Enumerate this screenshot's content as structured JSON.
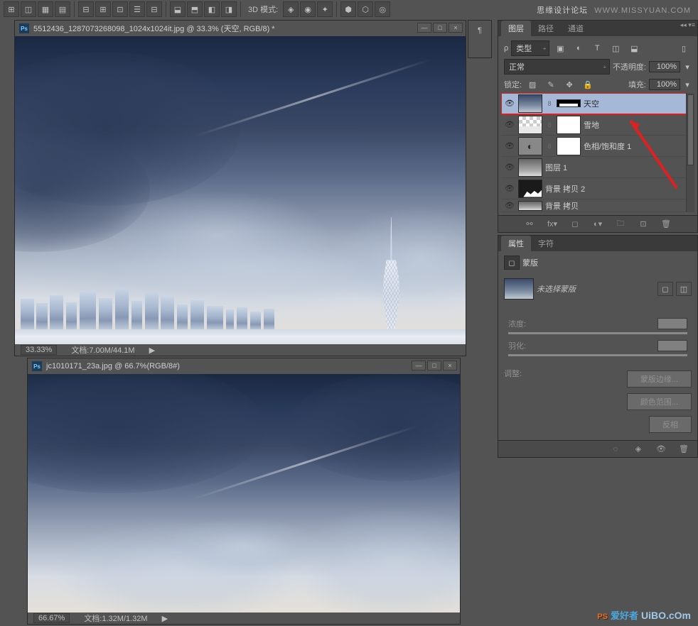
{
  "toolbar": {
    "mode_label": "3D 模式:"
  },
  "watermark_top": {
    "cn": "思缘设计论坛",
    "url": "WWW.MISSYUAN.COM"
  },
  "watermark_bottom": {
    "ps": "PS",
    "cn": "爱好者",
    "dom": "UiBO.cOm"
  },
  "doc1": {
    "title": "5512436_1287073268098_1024x1024it.jpg @ 33.3% (天空, RGB/8) *",
    "zoom": "33.33%",
    "doc_label": "文档:",
    "doc_size": "7.00M/44.1M"
  },
  "doc2": {
    "title": "jc1010171_23a.jpg @ 66.7%(RGB/8#)",
    "zoom": "66.67%",
    "doc_label": "文档:",
    "doc_size": "1.32M/1.32M"
  },
  "layers_panel": {
    "tabs": [
      "图层",
      "路径",
      "通道"
    ],
    "filter_label": "类型",
    "blend_mode": "正常",
    "opacity_label": "不透明度:",
    "opacity_value": "100%",
    "lock_label": "锁定:",
    "fill_label": "填充:",
    "fill_value": "100%",
    "layers": [
      {
        "name": "天空",
        "link": "8"
      },
      {
        "name": "雪地",
        "link": "8"
      },
      {
        "name": "色相/饱和度 1",
        "link": "8"
      },
      {
        "name": "图层 1"
      },
      {
        "name": "背景 拷贝 2"
      },
      {
        "name": "背景 拷贝"
      }
    ]
  },
  "props_panel": {
    "tabs": [
      "属性",
      "字符"
    ],
    "mask_label": "蒙版",
    "no_mask": "未选择蒙版",
    "density_label": "浓度:",
    "feather_label": "羽化:",
    "adjust_label": "调整:",
    "buttons": [
      "蒙版边缘...",
      "颜色范围...",
      "反相"
    ]
  }
}
